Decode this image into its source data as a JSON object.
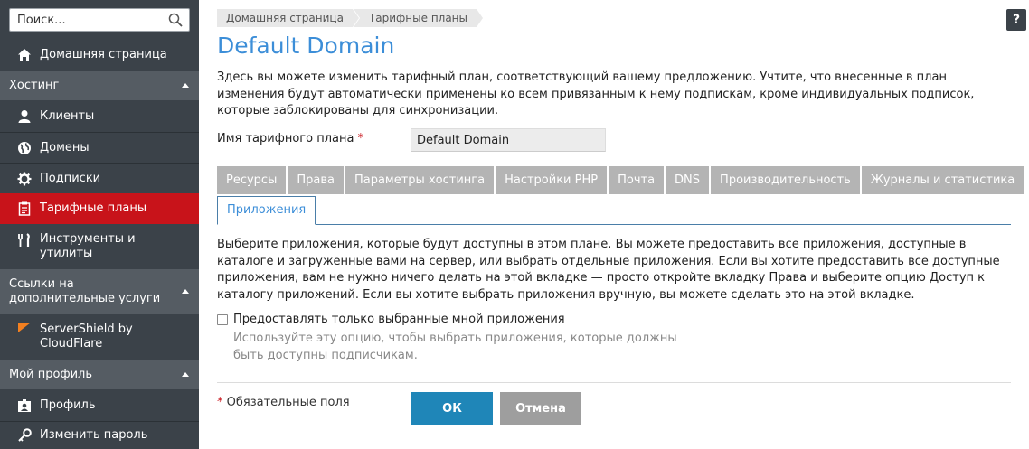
{
  "search": {
    "placeholder": "Поиск..."
  },
  "sidebar": {
    "home": "Домашняя страница",
    "sections": [
      {
        "title": "Хостинг",
        "items": [
          {
            "label": "Клиенты",
            "icon": "user-icon"
          },
          {
            "label": "Домены",
            "icon": "globe-icon"
          },
          {
            "label": "Подписки",
            "icon": "gear-icon"
          },
          {
            "label": "Тарифные планы",
            "icon": "plans-icon",
            "active": true
          },
          {
            "label": "Инструменты и утилиты",
            "icon": "tools-icon"
          }
        ]
      },
      {
        "title": "Ссылки на дополнительные услуги",
        "items": [
          {
            "label": "ServerShield by CloudFlare",
            "icon": "cloudflare-flag-icon"
          }
        ]
      },
      {
        "title": "Мой профиль",
        "items": [
          {
            "label": "Профиль",
            "icon": "profile-icon"
          },
          {
            "label": "Изменить пароль",
            "icon": "key-icon"
          }
        ]
      }
    ]
  },
  "breadcrumb": [
    "Домашняя страница",
    "Тарифные планы"
  ],
  "page_title": "Default Domain",
  "intro": "Здесь вы можете изменить тарифный план, соответствующий вашему предложению. Учтите, что внесенные в план изменения будут автоматически применены ко всем привязанным к нему подпискам, кроме индивидуальных подписок, которые заблокированы для синхронизации.",
  "plan_name": {
    "label": "Имя тарифного плана",
    "required_mark": "*",
    "value": "Default Domain"
  },
  "tabs": [
    "Ресурсы",
    "Права",
    "Параметры хостинга",
    "Настройки PHP",
    "Почта",
    "DNS",
    "Производительность",
    "Журналы и статистика"
  ],
  "active_tab": "Приложения",
  "description": "Выберите приложения, которые будут доступны в этом плане. Вы можете предоставить все приложения, доступные в каталоге и загруженные вами на сервер, или выбрать отдельные приложения. Если вы хотите предоставить все доступные приложения, вам не нужно ничего делать на этой вкладке — просто откройте вкладку Права и выберите опцию Доступ к каталогу приложений. Если вы хотите выбрать приложения вручную, вы можете сделать это на этой вкладке.",
  "option": {
    "label": "Предоставлять только выбранные мной приложения",
    "checked": false,
    "hint": "Используйте эту опцию, чтобы выбрать приложения, которые должны быть доступны подписчикам."
  },
  "footer": {
    "required_mark": "*",
    "required_note": "Обязательные поля",
    "ok": "ОК",
    "cancel": "Отмена"
  },
  "help": "?",
  "colors": {
    "accent": "#3c8ed8",
    "active_nav": "#c8131a",
    "ok_button": "#1f86b8",
    "sidebar_bg": "#3b4249"
  }
}
